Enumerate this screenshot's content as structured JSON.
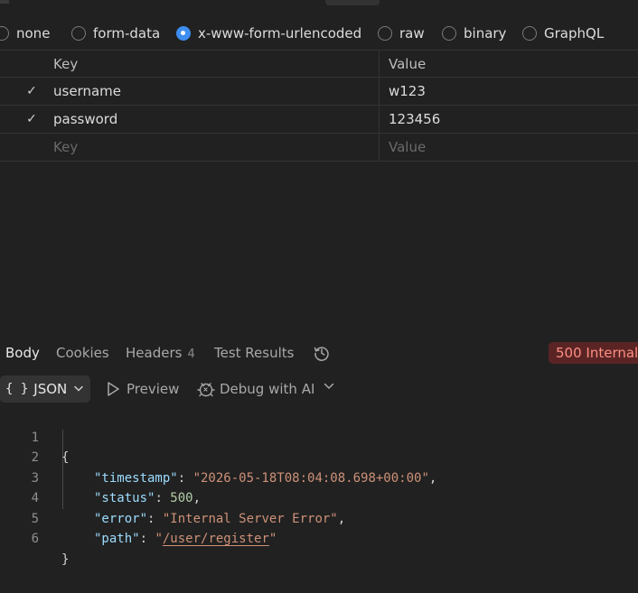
{
  "body_types": [
    {
      "label": "none",
      "selected": false
    },
    {
      "label": "form-data",
      "selected": false
    },
    {
      "label": "x-www-form-urlencoded",
      "selected": true
    },
    {
      "label": "raw",
      "selected": false
    },
    {
      "label": "binary",
      "selected": false
    },
    {
      "label": "GraphQL",
      "selected": false
    }
  ],
  "params_table": {
    "headers": {
      "key": "Key",
      "value": "Value"
    },
    "rows": [
      {
        "enabled": true,
        "key": "username",
        "value": "w123"
      },
      {
        "enabled": true,
        "key": "password",
        "value": "123456"
      }
    ],
    "placeholder": {
      "key": "Key",
      "value": "Value"
    }
  },
  "response_tabs": {
    "body": "Body",
    "cookies": "Cookies",
    "headers": "Headers",
    "headers_count": "4",
    "test_results": "Test Results",
    "status": "500 Internal"
  },
  "format_bar": {
    "format_icon": "{ }",
    "format": "JSON",
    "preview": "Preview",
    "debug": "Debug with AI"
  },
  "code": {
    "line_numbers": [
      "1",
      "2",
      "3",
      "4",
      "5",
      "6"
    ],
    "open_brace": "{",
    "close_brace": "}",
    "fields": {
      "timestamp_key": "\"timestamp\"",
      "timestamp_val": "\"2026-05-18T08:04:08.698+00:00\"",
      "status_key": "\"status\"",
      "status_val": "500",
      "error_key": "\"error\"",
      "error_val": "\"Internal Server Error\"",
      "path_key": "\"path\"",
      "path_quote": "\"",
      "path_val": "/user/register"
    }
  },
  "colors": {
    "accent": "#3d8ef0",
    "error_badge_bg": "#5a2424",
    "error_badge_text": "#ff8e82",
    "json_key": "#9cdcfe",
    "json_string": "#ce9178",
    "json_number": "#b5cea8"
  }
}
